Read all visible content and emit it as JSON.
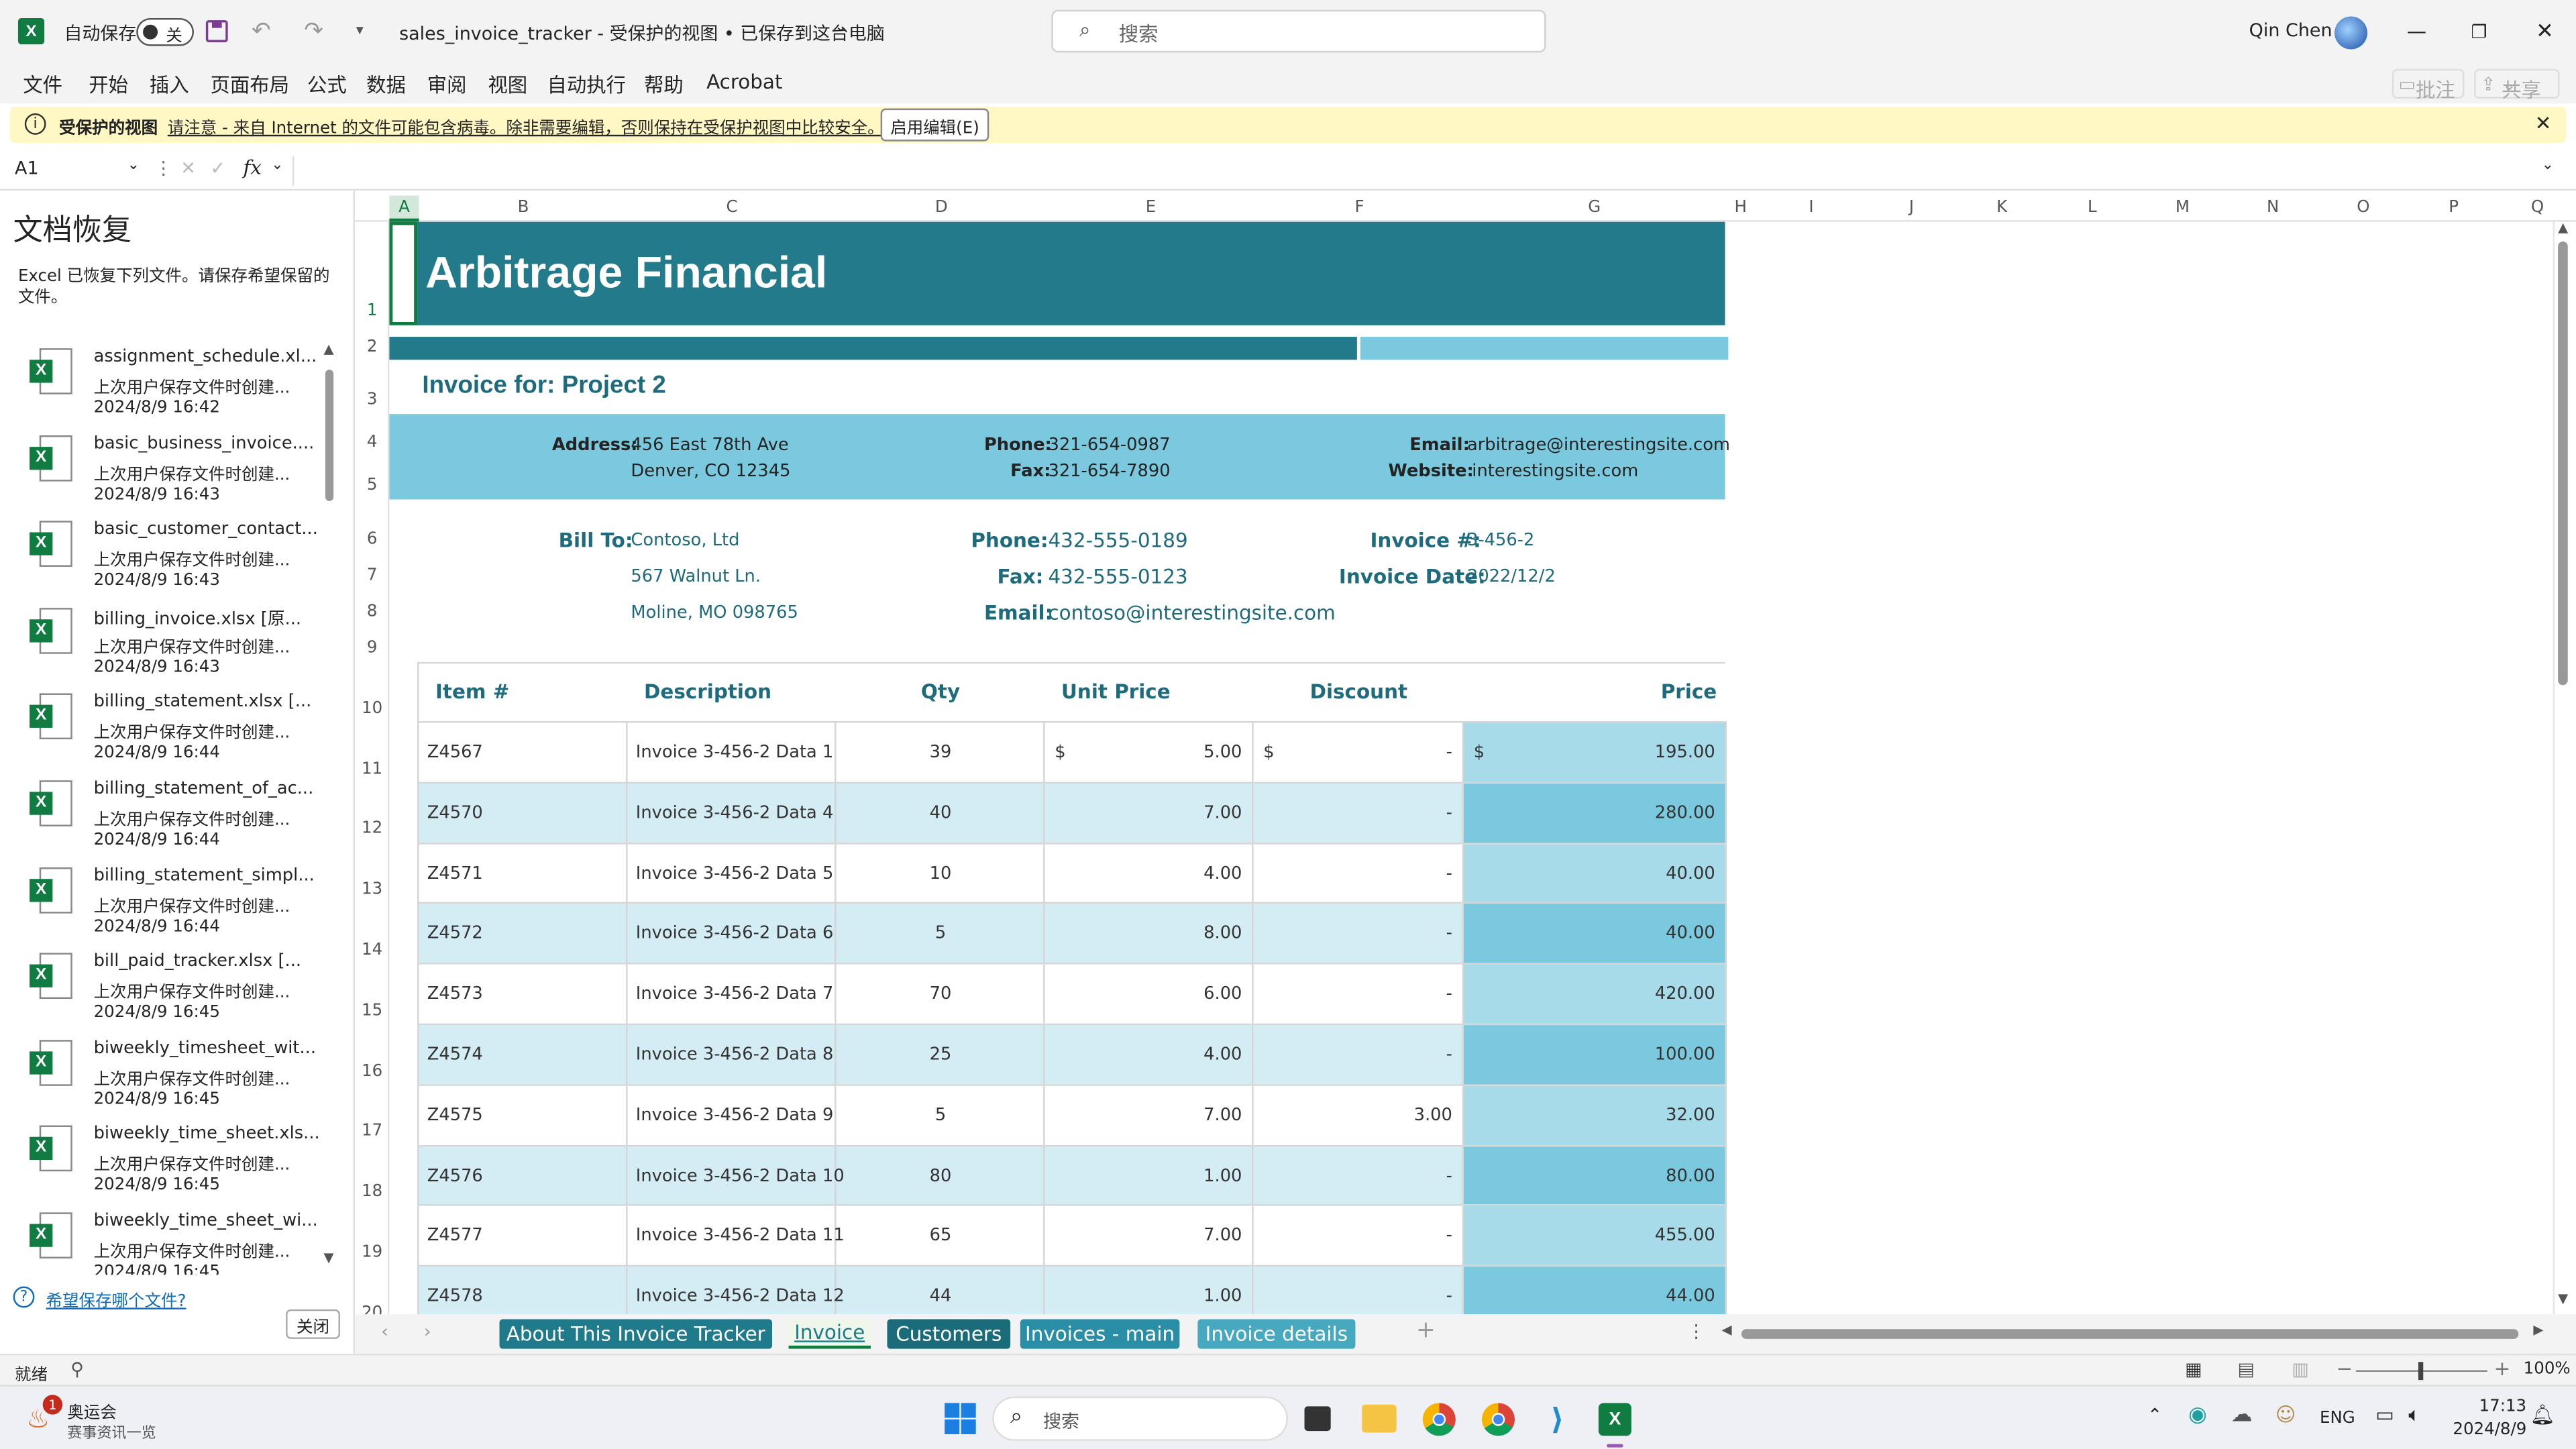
{
  "window": {
    "autosave_label": "自动保存",
    "autosave_state": "关",
    "title": "sales_invoice_tracker  -  受保护的视图 • 已保存到这台电脑",
    "search_placeholder": "搜索",
    "user": "Qin Chen"
  },
  "menu": [
    "文件",
    "开始",
    "插入",
    "页面布局",
    "公式",
    "数据",
    "审阅",
    "视图",
    "自动执行",
    "帮助",
    "Acrobat"
  ],
  "menu_right": {
    "comments": "批注",
    "share": "共享"
  },
  "protected": {
    "title": "受保护的视图",
    "message": "请注意 - 来自 Internet 的文件可能包含病毒。除非需要编辑，否则保持在受保护视图中比较安全。",
    "button": "启用编辑(E)"
  },
  "formula_bar": {
    "cell_ref": "A1",
    "fx": "fx",
    "value": ""
  },
  "recovery": {
    "title": "文档恢复",
    "description": "Excel 已恢复下列文件。请保存希望保留的文件。",
    "items": [
      {
        "name": "assignment_schedule.xl...",
        "desc": "上次用户保存文件时创建...",
        "time": "2024/8/9 16:42"
      },
      {
        "name": "basic_business_invoice....",
        "desc": "上次用户保存文件时创建...",
        "time": "2024/8/9 16:43"
      },
      {
        "name": "basic_customer_contact...",
        "desc": "上次用户保存文件时创建...",
        "time": "2024/8/9 16:43"
      },
      {
        "name": "billing_invoice.xlsx  [原...",
        "desc": "上次用户保存文件时创建...",
        "time": "2024/8/9 16:43"
      },
      {
        "name": "billing_statement.xlsx  [...",
        "desc": "上次用户保存文件时创建...",
        "time": "2024/8/9 16:44"
      },
      {
        "name": "billing_statement_of_ac...",
        "desc": "上次用户保存文件时创建...",
        "time": "2024/8/9 16:44"
      },
      {
        "name": "billing_statement_simpl...",
        "desc": "上次用户保存文件时创建...",
        "time": "2024/8/9 16:44"
      },
      {
        "name": "bill_paid_tracker.xlsx  [...",
        "desc": "上次用户保存文件时创建...",
        "time": "2024/8/9 16:45"
      },
      {
        "name": "biweekly_timesheet_wit...",
        "desc": "上次用户保存文件时创建...",
        "time": "2024/8/9 16:45"
      },
      {
        "name": "biweekly_time_sheet.xls...",
        "desc": "上次用户保存文件时创建...",
        "time": "2024/8/9 16:45"
      },
      {
        "name": "biweekly_time_sheet_wi...",
        "desc": "上次用户保存文件时创建...",
        "time": "2024/8/9 16:45"
      }
    ],
    "question": "希望保存哪个文件?",
    "close": "关闭"
  },
  "columns": [
    "A",
    "B",
    "C",
    "D",
    "E",
    "F",
    "G",
    "H",
    "I",
    "J",
    "K",
    "L",
    "M",
    "N",
    "O",
    "P",
    "Q"
  ],
  "rows": [
    "1",
    "2",
    "3",
    "4",
    "5",
    "6",
    "7",
    "8",
    "9",
    "10",
    "11",
    "12",
    "13",
    "14",
    "15",
    "16",
    "17",
    "18",
    "19",
    "20"
  ],
  "sheet": {
    "company": "Arbitrage Financial",
    "invoice_for": "Invoice for: Project 2",
    "address_label": "Address:",
    "address_line1": "456 East 78th Ave",
    "address_line2": "Denver, CO 12345",
    "phone_label": "Phone:",
    "phone": "321-654-0987",
    "fax_label": "Fax:",
    "fax": "321-654-7890",
    "email_label": "Email:",
    "email": "arbitrage@interestingsite.com",
    "website_label": "Website:",
    "website": "interestingsite.com",
    "bill_to_label": "Bill To:",
    "bill_to_name": "Contoso, Ltd",
    "bill_to_street": "567 Walnut Ln.",
    "bill_to_city": "Moline, MO 098765",
    "cust_phone_label": "Phone:",
    "cust_phone": "432-555-0189",
    "cust_fax_label": "Fax:",
    "cust_fax": "432-555-0123",
    "cust_email_label": "Email:",
    "cust_email": "contoso@interestingsite.com",
    "invoice_no_label": "Invoice #:",
    "invoice_no": "3-456-2",
    "invoice_date_label": "Invoice Date:",
    "invoice_date": "2022/12/2",
    "headers": [
      "Item #",
      "Description",
      "Qty",
      "Unit Price",
      "Discount",
      "Price"
    ],
    "currency": "$",
    "items": [
      {
        "item": "Z4567",
        "desc": "Invoice 3-456-2 Data 1",
        "qty": "39",
        "unit": "5.00",
        "disc": "-",
        "price": "195.00"
      },
      {
        "item": "Z4570",
        "desc": "Invoice 3-456-2 Data 4",
        "qty": "40",
        "unit": "7.00",
        "disc": "-",
        "price": "280.00"
      },
      {
        "item": "Z4571",
        "desc": "Invoice 3-456-2 Data 5",
        "qty": "10",
        "unit": "4.00",
        "disc": "-",
        "price": "40.00"
      },
      {
        "item": "Z4572",
        "desc": "Invoice 3-456-2 Data 6",
        "qty": "5",
        "unit": "8.00",
        "disc": "-",
        "price": "40.00"
      },
      {
        "item": "Z4573",
        "desc": "Invoice 3-456-2 Data 7",
        "qty": "70",
        "unit": "6.00",
        "disc": "-",
        "price": "420.00"
      },
      {
        "item": "Z4574",
        "desc": "Invoice 3-456-2 Data 8",
        "qty": "25",
        "unit": "4.00",
        "disc": "-",
        "price": "100.00"
      },
      {
        "item": "Z4575",
        "desc": "Invoice 3-456-2 Data 9",
        "qty": "5",
        "unit": "7.00",
        "disc": "3.00",
        "price": "32.00"
      },
      {
        "item": "Z4576",
        "desc": "Invoice 3-456-2 Data 10",
        "qty": "80",
        "unit": "1.00",
        "disc": "-",
        "price": "80.00"
      },
      {
        "item": "Z4577",
        "desc": "Invoice 3-456-2 Data 11",
        "qty": "65",
        "unit": "7.00",
        "disc": "-",
        "price": "455.00"
      },
      {
        "item": "Z4578",
        "desc": "Invoice 3-456-2 Data 12",
        "qty": "44",
        "unit": "1.00",
        "disc": "-",
        "price": "44.00"
      }
    ]
  },
  "sheet_tabs": [
    "About This Invoice Tracker",
    "Invoice",
    "Customers",
    "Invoices - main",
    "Invoice details"
  ],
  "status": {
    "ready": "就绪",
    "zoom": "100%"
  },
  "taskbar": {
    "widget_title": "奥运会",
    "widget_sub": "赛事资讯一览",
    "widget_badge": "1",
    "search": "搜索",
    "lang": "ENG",
    "time": "17:13",
    "date": "2024/8/9"
  },
  "colors": {
    "teal_dark": "#237a8b",
    "teal_light": "#7bc9de",
    "band": "#d4ecf3",
    "price_band": "#a8dbe9",
    "excel_green": "#107c41"
  }
}
